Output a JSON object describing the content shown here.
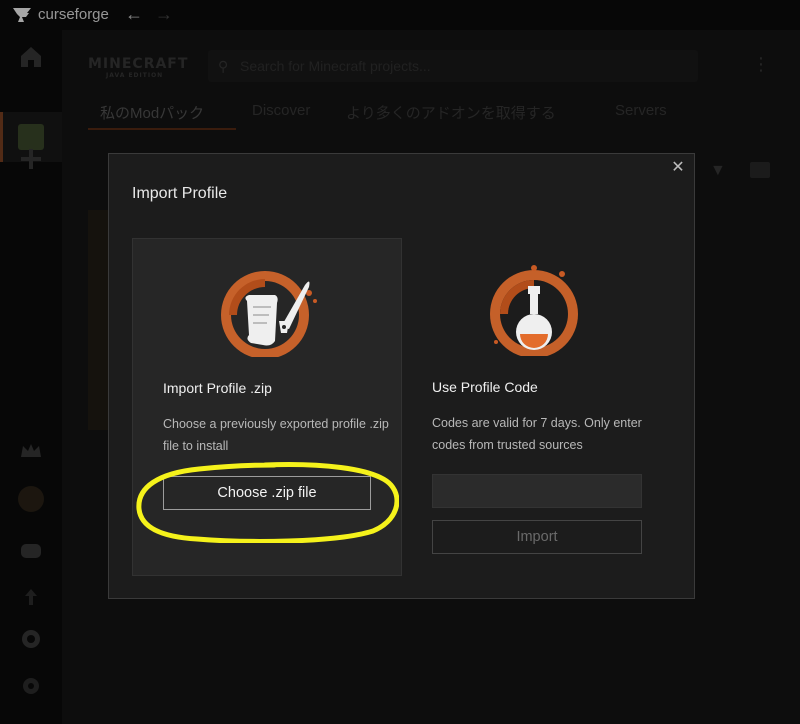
{
  "app": {
    "name": "curseforge",
    "brand_color": "#e36c2b"
  },
  "header": {
    "game_logo": "MINECRAFT",
    "game_logo_sub": "JAVA EDITION",
    "search_placeholder": "Search for Minecraft projects..."
  },
  "tabs": [
    {
      "label": "私のModパック",
      "active": true
    },
    {
      "label": "Discover",
      "active": false
    },
    {
      "label": "より多くのアドオンを取得する",
      "active": false
    },
    {
      "label": "Servers",
      "active": false
    }
  ],
  "modal": {
    "title": "Import Profile",
    "close_icon": "close-icon",
    "options": [
      {
        "title": "Import Profile .zip",
        "description": "Choose a previously exported profile .zip file to install",
        "button": "Choose .zip file",
        "icon": "scroll-quill-icon"
      },
      {
        "title": "Use Profile Code",
        "description": "Codes are valid for 7 days. Only enter codes from trusted sources",
        "input_value": "",
        "button": "Import",
        "icon": "potion-bottle-icon"
      }
    ]
  },
  "annotation": {
    "color": "#f5f21b",
    "target": "Choose .zip file"
  }
}
